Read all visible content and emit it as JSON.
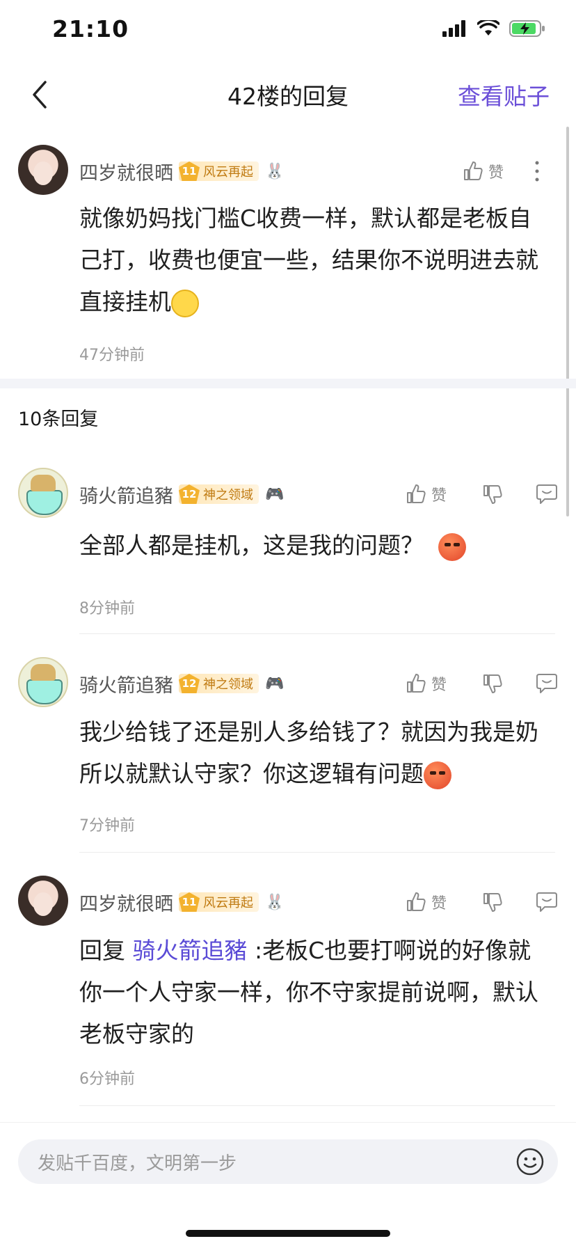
{
  "status": {
    "time": "21:10"
  },
  "nav": {
    "title": "42楼的回复",
    "right_action": "查看贴子"
  },
  "main_comment": {
    "username": "四岁就很晒",
    "level": "11",
    "level_title": "风云再起",
    "like_label": "赞",
    "text": "就像奶妈找门槛C收费一样，默认都是老板自己打，收费也便宜一些，结果你不说明进去就直接挂机",
    "time": "47分钟前"
  },
  "reply_count": "10条回复",
  "replies": [
    {
      "username": "骑火箭追豬",
      "level": "12",
      "level_title": "神之领域",
      "like_label": "赞",
      "text": "全部人都是挂机，这是我的问题？",
      "time": "8分钟前"
    },
    {
      "username": "骑火箭追豬",
      "level": "12",
      "level_title": "神之领域",
      "like_label": "赞",
      "text": "我少给钱了还是别人多给钱了？就因为我是奶所以就默认守家？你这逻辑有问题",
      "time": "7分钟前"
    },
    {
      "username": "四岁就很晒",
      "level": "11",
      "level_title": "风云再起",
      "like_label": "赞",
      "reply_prefix": "回复",
      "mention": "骑火箭追豬",
      "text": ":老板C也要打啊说的好像就你一个人守家一样，你不守家提前说啊，默认老板守家的",
      "time": "6分钟前"
    }
  ],
  "input": {
    "placeholder": "发贴千百度，文明第一步"
  },
  "colors": {
    "accent": "#6b4fd8",
    "mention": "#5a4bd6",
    "badge": "#f3b22e"
  }
}
